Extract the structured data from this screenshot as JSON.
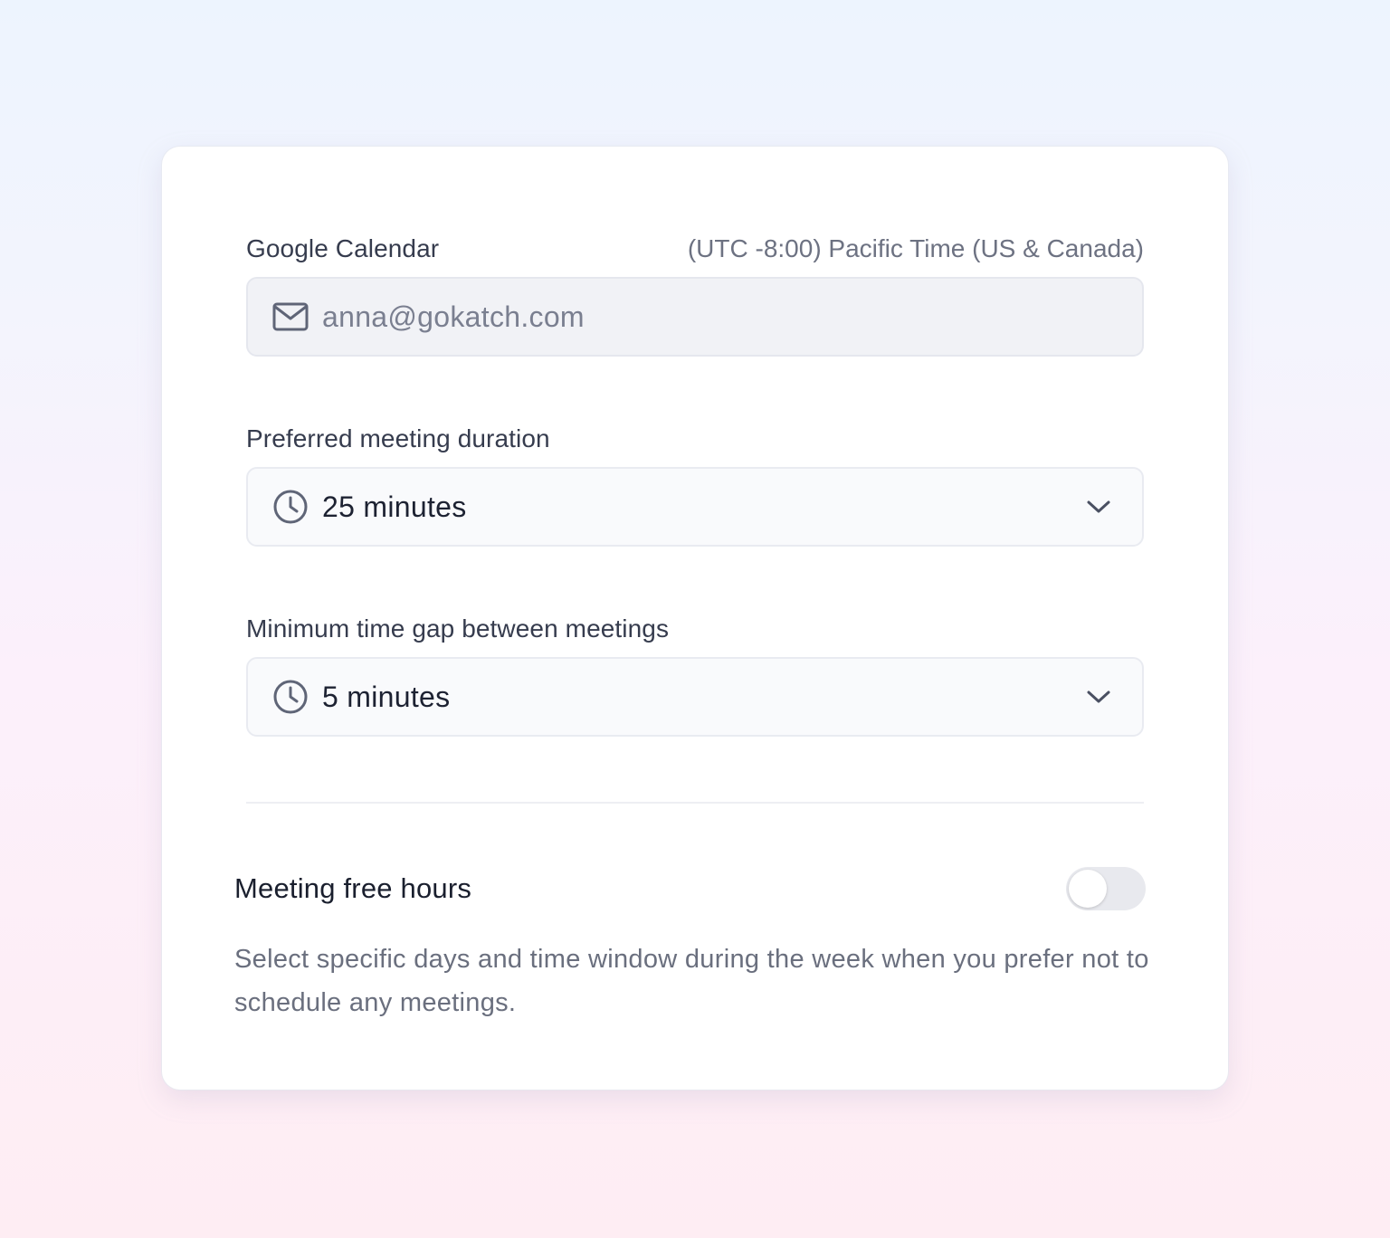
{
  "calendar": {
    "label": "Google Calendar",
    "timezone": "(UTC -8:00) Pacific Time (US & Canada)",
    "email": "anna@gokatch.com",
    "email_icon": "mail-icon"
  },
  "duration": {
    "label": "Preferred meeting duration",
    "value": "25 minutes",
    "icon": "clock-icon"
  },
  "gap": {
    "label": "Minimum time gap between meetings",
    "value": "5 minutes",
    "icon": "clock-icon"
  },
  "meeting_free_hours": {
    "title": "Meeting free hours",
    "enabled": false,
    "description": "Select specific days and time window during the week when you prefer not to schedule any meetings."
  },
  "colors": {
    "toggle_off": "#e8e9ee",
    "field_disabled_bg": "#f1f2f6",
    "field_bg": "#f9fafc"
  }
}
